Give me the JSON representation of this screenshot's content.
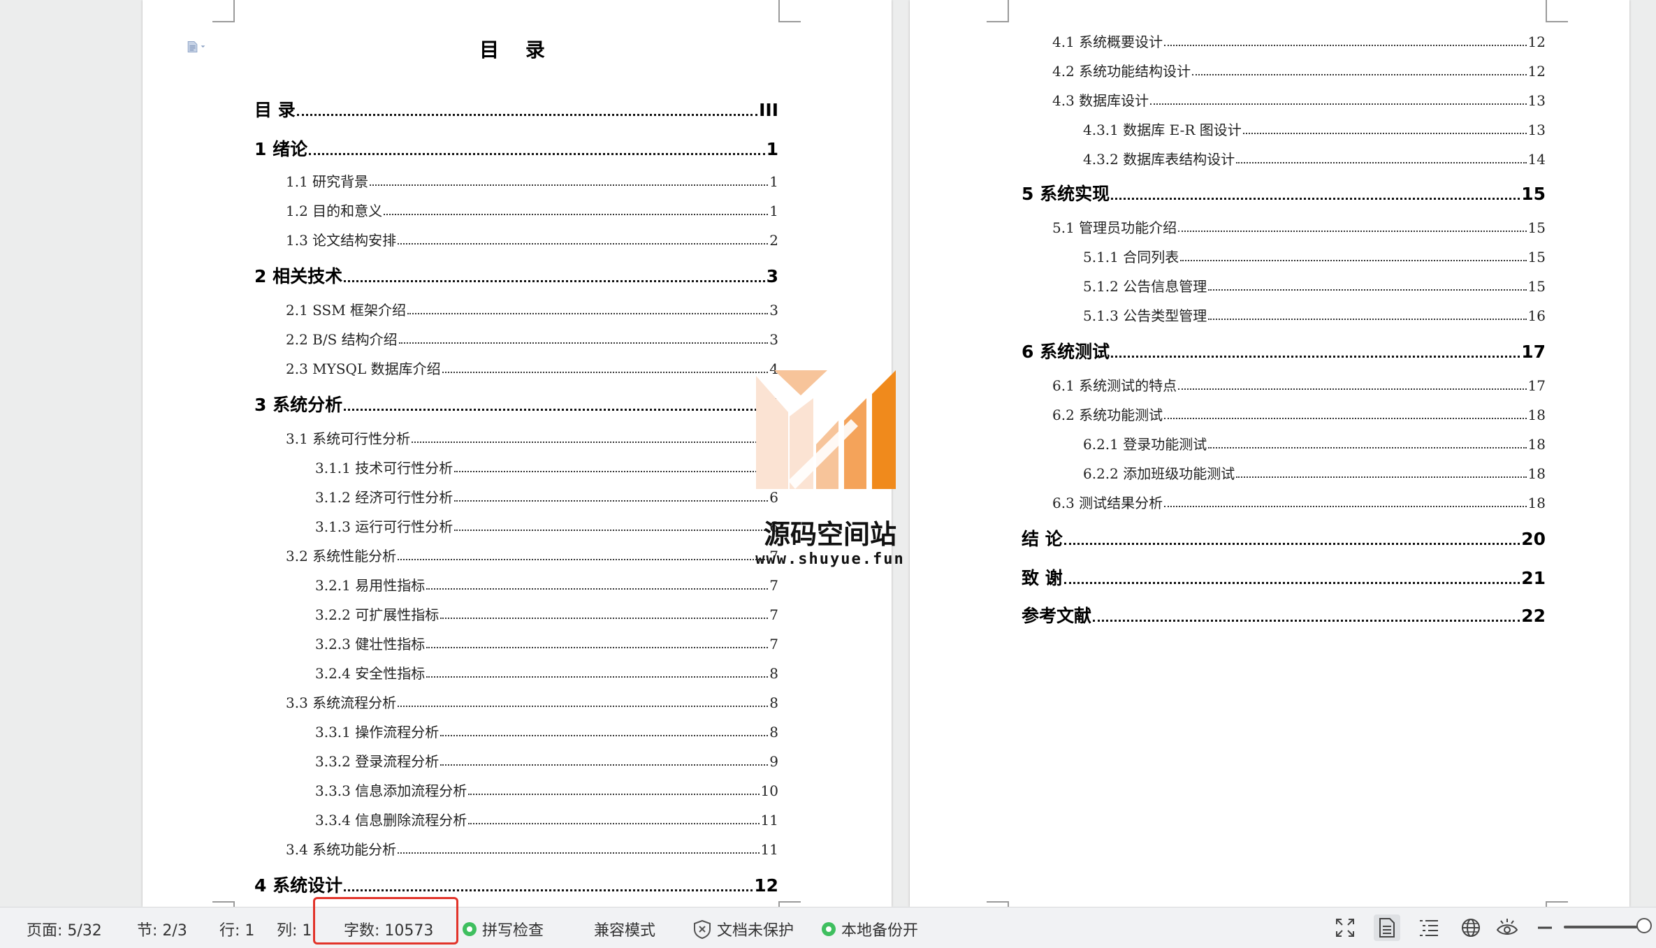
{
  "document": {
    "heading": "目 录",
    "left_toc": [
      {
        "text": "目 录",
        "page": "III",
        "level": 1
      },
      {
        "text": "1 绪论",
        "page": "1",
        "level": 1
      },
      {
        "text": "1.1 研究背景",
        "page": "1",
        "level": 2
      },
      {
        "text": "1.2 目的和意义",
        "page": "1",
        "level": 2
      },
      {
        "text": "1.3 论文结构安排",
        "page": "2",
        "level": 2
      },
      {
        "text": "2 相关技术",
        "page": "3",
        "level": 1
      },
      {
        "text": "2.1 SSM 框架介绍",
        "page": "3",
        "level": 2
      },
      {
        "text": "2.2 B/S 结构介绍",
        "page": "3",
        "level": 2
      },
      {
        "text": "2.3 MYSQL 数据库介绍",
        "page": "4",
        "level": 2
      },
      {
        "text": "3 系统分析",
        "page": "5",
        "level": 1
      },
      {
        "text": "3.1 系统可行性分析",
        "page": "5",
        "level": 2
      },
      {
        "text": "3.1.1 技术可行性分析",
        "page": "5",
        "level": 3
      },
      {
        "text": "3.1.2 经济可行性分析",
        "page": "6",
        "level": 3
      },
      {
        "text": "3.1.3 运行可行性分析",
        "page": "6",
        "level": 3
      },
      {
        "text": "3.2 系统性能分析",
        "page": "7",
        "level": 2
      },
      {
        "text": "3.2.1 易用性指标",
        "page": "7",
        "level": 3
      },
      {
        "text": "3.2.2 可扩展性指标",
        "page": "7",
        "level": 3
      },
      {
        "text": "3.2.3 健壮性指标",
        "page": "7",
        "level": 3
      },
      {
        "text": "3.2.4 安全性指标",
        "page": "8",
        "level": 3
      },
      {
        "text": "3.3 系统流程分析",
        "page": "8",
        "level": 2
      },
      {
        "text": "3.3.1 操作流程分析",
        "page": "8",
        "level": 3
      },
      {
        "text": "3.3.2 登录流程分析",
        "page": "9",
        "level": 3
      },
      {
        "text": "3.3.3 信息添加流程分析",
        "page": "10",
        "level": 3
      },
      {
        "text": "3.3.4 信息删除流程分析",
        "page": "11",
        "level": 3
      },
      {
        "text": "3.4 系统功能分析",
        "page": "11",
        "level": 2
      },
      {
        "text": "4 系统设计",
        "page": "12",
        "level": 1
      }
    ],
    "right_toc": [
      {
        "text": "4.1 系统概要设计",
        "page": "12",
        "level": 2
      },
      {
        "text": "4.2 系统功能结构设计",
        "page": "12",
        "level": 2
      },
      {
        "text": "4.3 数据库设计",
        "page": "13",
        "level": 2
      },
      {
        "text": "4.3.1 数据库 E-R 图设计",
        "page": "13",
        "level": 3
      },
      {
        "text": "4.3.2 数据库表结构设计",
        "page": "14",
        "level": 3
      },
      {
        "text": "5 系统实现",
        "page": "15",
        "level": 1
      },
      {
        "text": "5.1 管理员功能介绍",
        "page": "15",
        "level": 2
      },
      {
        "text": "5.1.1 合同列表",
        "page": "15",
        "level": 3
      },
      {
        "text": "5.1.2 公告信息管理",
        "page": "15",
        "level": 3
      },
      {
        "text": "5.1.3 公告类型管理",
        "page": "16",
        "level": 3
      },
      {
        "text": "6 系统测试",
        "page": "17",
        "level": 1
      },
      {
        "text": "6.1 系统测试的特点",
        "page": "17",
        "level": 2
      },
      {
        "text": "6.2 系统功能测试",
        "page": "18",
        "level": 2
      },
      {
        "text": "6.2.1 登录功能测试",
        "page": "18",
        "level": 3
      },
      {
        "text": "6.2.2 添加班级功能测试",
        "page": "18",
        "level": 3
      },
      {
        "text": "6.3 测试结果分析",
        "page": "18",
        "level": 2
      },
      {
        "text": "结 论",
        "page": "20",
        "level": 1
      },
      {
        "text": "致 谢",
        "page": "21",
        "level": 1
      },
      {
        "text": "参考文献",
        "page": "22",
        "level": 1
      }
    ]
  },
  "watermark": {
    "name": "源码空间站",
    "url": "www.shuyue.fun",
    "colors": {
      "orange": "#f08a1c",
      "light": "#f7c49a",
      "pale": "#fbe3d3"
    }
  },
  "statusbar": {
    "page": "页面: 5/32",
    "section": "节: 2/3",
    "row": "行: 1",
    "col": "列: 1",
    "word_count": "字数: 10573",
    "spell_check": "拼写检查",
    "compat_mode": "兼容模式",
    "doc_protect": "文档未保护",
    "local_backup": "本地备份开",
    "highlight_color": "#e2342a",
    "icons": [
      "fullscreen-icon",
      "page-view-icon",
      "outline-view-icon",
      "web-view-icon",
      "reading-mode-icon",
      "zoom-out-icon",
      "zoom-slider"
    ]
  }
}
